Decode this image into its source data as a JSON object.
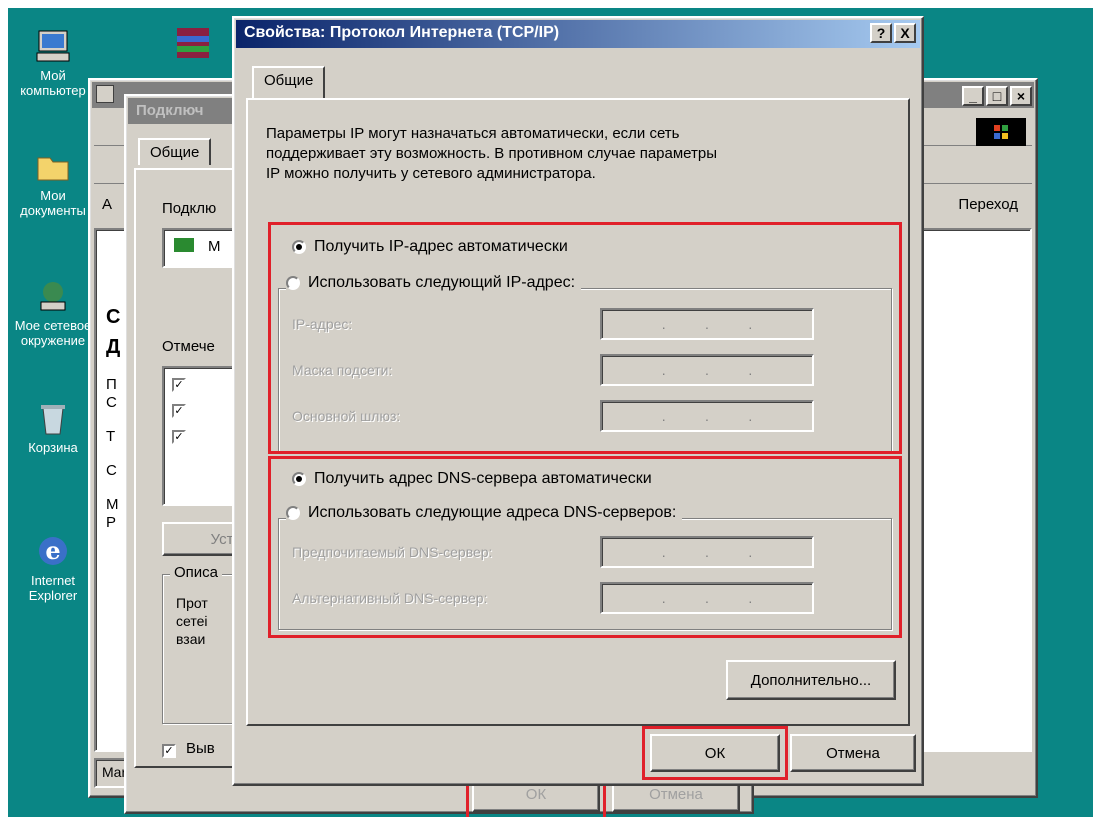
{
  "desktop": {
    "icons": [
      {
        "label": "Мой компьютер",
        "icon": "my-computer-icon"
      },
      {
        "label": "Мои документы",
        "icon": "folder-icon"
      },
      {
        "label": "Мое сетевое окружение",
        "icon": "network-icon"
      },
      {
        "label": "Корзина",
        "icon": "recycle-bin-icon"
      },
      {
        "label": "Internet Explorer",
        "icon": "internet-explorer-icon"
      }
    ]
  },
  "back_window": {
    "address_label": "А",
    "go_label": "Переход",
    "status_text": "Mar",
    "sidebar_glyphs": [
      "С",
      "Д",
      "П",
      "С",
      "Т",
      "С",
      "М",
      "Р"
    ]
  },
  "mid_dialog": {
    "title": "Подключ",
    "tab_label": "Общие",
    "connect_label": "Подклю",
    "adapter_text": "М",
    "components_label": "Отмече",
    "install_button": "Уст",
    "description_label": "Описа",
    "description_lines": [
      "Прот",
      "сетеі",
      "взаи"
    ],
    "show_icon_label": "Выв",
    "ok_button": "ОК",
    "cancel_button": "Отмена"
  },
  "dialog": {
    "title": "Свойства: Протокол Интернета (TCP/IP)",
    "help_button": "?",
    "close_button": "X",
    "tab_label": "Общие",
    "description": [
      "Параметры IP могут назначаться автоматически, если сеть",
      "поддерживает эту возможность. В противном случае параметры",
      "IP можно получить у сетевого администратора."
    ],
    "ip_auto_label": "Получить IP-адрес автоматически",
    "ip_manual_label": "Использовать следующий IP-адрес:",
    "ip_address_label": "IP-адрес:",
    "subnet_label": "Маска подсети:",
    "gateway_label": "Основной шлюз:",
    "dns_auto_label": "Получить адрес DNS-сервера автоматически",
    "dns_manual_label": "Использовать следующие адреса DNS-серверов:",
    "preferred_dns_label": "Предпочитаемый DNS-сервер:",
    "alternate_dns_label": "Альтернативный DNS-сервер:",
    "advanced_button": "Дополнительно...",
    "ok_button": "ОК",
    "cancel_button": "Отмена",
    "ip_mode": "auto",
    "dns_mode": "auto"
  },
  "colors": {
    "desktop": "#0a8685",
    "highlight_box": "#e0202a",
    "active_title": "#0a246a"
  }
}
